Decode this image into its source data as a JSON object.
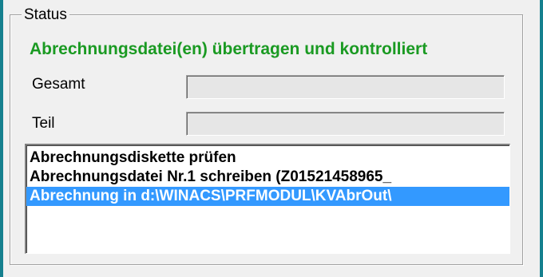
{
  "group": {
    "title": "Status"
  },
  "status_message": "Abrechnungsdatei(en) übertragen und kontrolliert",
  "progress": {
    "total_label": "Gesamt",
    "total_value": 0,
    "part_label": "Teil",
    "part_value": 0
  },
  "log": {
    "items": [
      "Abrechnungsdiskette prüfen",
      "Abrechnungsdatei Nr.1 schreiben  (Z01521458965_",
      "Abrechnung in d:\\WINACS\\PRFMODUL\\KVAbrOut\\"
    ],
    "selected_index": 2
  },
  "colors": {
    "status_text": "#1a9a22",
    "selection": "#3399ff",
    "window_edge": "#15808e"
  }
}
